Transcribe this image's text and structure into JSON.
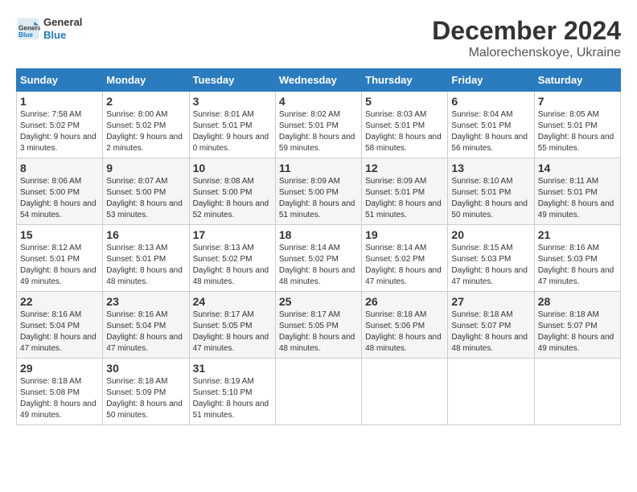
{
  "logo": {
    "line1": "General",
    "line2": "Blue"
  },
  "title": {
    "month_year": "December 2024",
    "location": "Malorechenskoye, Ukraine"
  },
  "days_of_week": [
    "Sunday",
    "Monday",
    "Tuesday",
    "Wednesday",
    "Thursday",
    "Friday",
    "Saturday"
  ],
  "weeks": [
    [
      {
        "day": "1",
        "sunrise": "7:58 AM",
        "sunset": "5:02 PM",
        "daylight_hours": "9 hours and 3 minutes."
      },
      {
        "day": "2",
        "sunrise": "8:00 AM",
        "sunset": "5:02 PM",
        "daylight_hours": "9 hours and 2 minutes."
      },
      {
        "day": "3",
        "sunrise": "8:01 AM",
        "sunset": "5:01 PM",
        "daylight_hours": "9 hours and 0 minutes."
      },
      {
        "day": "4",
        "sunrise": "8:02 AM",
        "sunset": "5:01 PM",
        "daylight_hours": "8 hours and 59 minutes."
      },
      {
        "day": "5",
        "sunrise": "8:03 AM",
        "sunset": "5:01 PM",
        "daylight_hours": "8 hours and 58 minutes."
      },
      {
        "day": "6",
        "sunrise": "8:04 AM",
        "sunset": "5:01 PM",
        "daylight_hours": "8 hours and 56 minutes."
      },
      {
        "day": "7",
        "sunrise": "8:05 AM",
        "sunset": "5:01 PM",
        "daylight_hours": "8 hours and 55 minutes."
      }
    ],
    [
      {
        "day": "8",
        "sunrise": "8:06 AM",
        "sunset": "5:00 PM",
        "daylight_hours": "8 hours and 54 minutes."
      },
      {
        "day": "9",
        "sunrise": "8:07 AM",
        "sunset": "5:00 PM",
        "daylight_hours": "8 hours and 53 minutes."
      },
      {
        "day": "10",
        "sunrise": "8:08 AM",
        "sunset": "5:00 PM",
        "daylight_hours": "8 hours and 52 minutes."
      },
      {
        "day": "11",
        "sunrise": "8:09 AM",
        "sunset": "5:00 PM",
        "daylight_hours": "8 hours and 51 minutes."
      },
      {
        "day": "12",
        "sunrise": "8:09 AM",
        "sunset": "5:01 PM",
        "daylight_hours": "8 hours and 51 minutes."
      },
      {
        "day": "13",
        "sunrise": "8:10 AM",
        "sunset": "5:01 PM",
        "daylight_hours": "8 hours and 50 minutes."
      },
      {
        "day": "14",
        "sunrise": "8:11 AM",
        "sunset": "5:01 PM",
        "daylight_hours": "8 hours and 49 minutes."
      }
    ],
    [
      {
        "day": "15",
        "sunrise": "8:12 AM",
        "sunset": "5:01 PM",
        "daylight_hours": "8 hours and 49 minutes."
      },
      {
        "day": "16",
        "sunrise": "8:13 AM",
        "sunset": "5:01 PM",
        "daylight_hours": "8 hours and 48 minutes."
      },
      {
        "day": "17",
        "sunrise": "8:13 AM",
        "sunset": "5:02 PM",
        "daylight_hours": "8 hours and 48 minutes."
      },
      {
        "day": "18",
        "sunrise": "8:14 AM",
        "sunset": "5:02 PM",
        "daylight_hours": "8 hours and 48 minutes."
      },
      {
        "day": "19",
        "sunrise": "8:14 AM",
        "sunset": "5:02 PM",
        "daylight_hours": "8 hours and 47 minutes."
      },
      {
        "day": "20",
        "sunrise": "8:15 AM",
        "sunset": "5:03 PM",
        "daylight_hours": "8 hours and 47 minutes."
      },
      {
        "day": "21",
        "sunrise": "8:16 AM",
        "sunset": "5:03 PM",
        "daylight_hours": "8 hours and 47 minutes."
      }
    ],
    [
      {
        "day": "22",
        "sunrise": "8:16 AM",
        "sunset": "5:04 PM",
        "daylight_hours": "8 hours and 47 minutes."
      },
      {
        "day": "23",
        "sunrise": "8:16 AM",
        "sunset": "5:04 PM",
        "daylight_hours": "8 hours and 47 minutes."
      },
      {
        "day": "24",
        "sunrise": "8:17 AM",
        "sunset": "5:05 PM",
        "daylight_hours": "8 hours and 47 minutes."
      },
      {
        "day": "25",
        "sunrise": "8:17 AM",
        "sunset": "5:05 PM",
        "daylight_hours": "8 hours and 48 minutes."
      },
      {
        "day": "26",
        "sunrise": "8:18 AM",
        "sunset": "5:06 PM",
        "daylight_hours": "8 hours and 48 minutes."
      },
      {
        "day": "27",
        "sunrise": "8:18 AM",
        "sunset": "5:07 PM",
        "daylight_hours": "8 hours and 48 minutes."
      },
      {
        "day": "28",
        "sunrise": "8:18 AM",
        "sunset": "5:07 PM",
        "daylight_hours": "8 hours and 49 minutes."
      }
    ],
    [
      {
        "day": "29",
        "sunrise": "8:18 AM",
        "sunset": "5:08 PM",
        "daylight_hours": "8 hours and 49 minutes."
      },
      {
        "day": "30",
        "sunrise": "8:18 AM",
        "sunset": "5:09 PM",
        "daylight_hours": "8 hours and 50 minutes."
      },
      {
        "day": "31",
        "sunrise": "8:19 AM",
        "sunset": "5:10 PM",
        "daylight_hours": "8 hours and 51 minutes."
      },
      null,
      null,
      null,
      null
    ]
  ],
  "labels": {
    "sunrise": "Sunrise:",
    "sunset": "Sunset:",
    "daylight": "Daylight:"
  }
}
